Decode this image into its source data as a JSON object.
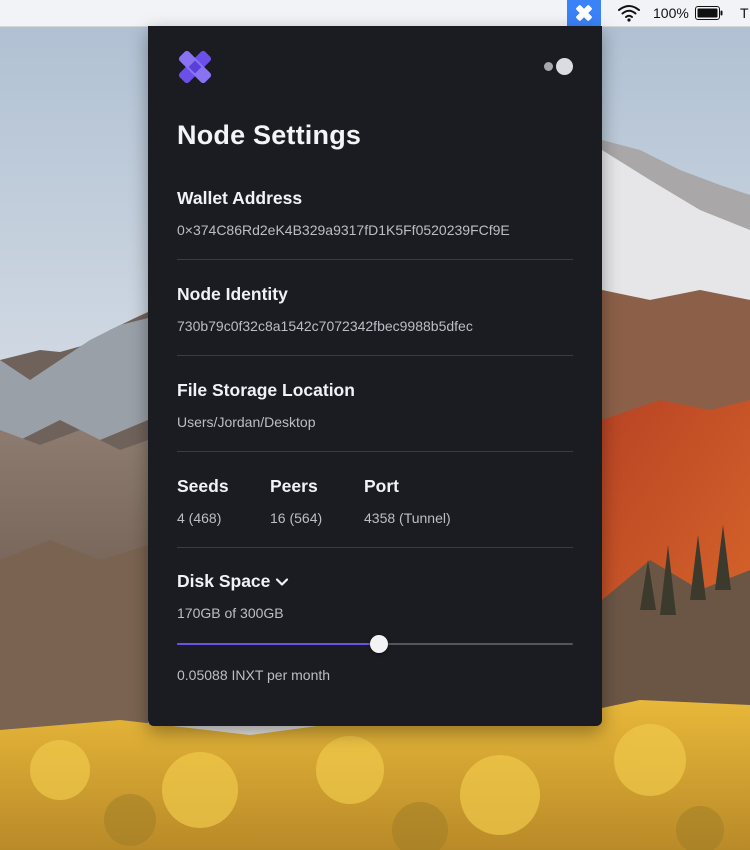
{
  "menubar": {
    "app_icon": "internxt-logo-icon",
    "wifi_icon": "wifi-icon",
    "battery_percent": "100%",
    "battery_icon": "battery-icon",
    "clock_partial": "T"
  },
  "panel": {
    "logo_icon": "internxt-logo-icon",
    "toggle_icon": "status-toggle-icon",
    "title": "Node Settings",
    "wallet": {
      "label": "Wallet Address",
      "value": "0×374C86Rd2eK4B329a9317fD1K5Ff0520239FCf9E"
    },
    "identity": {
      "label": "Node Identity",
      "value": "730b79c0f32c8a1542c7072342fbec9988b5dfec"
    },
    "storage": {
      "label": "File Storage Location",
      "value": "Users/Jordan/Desktop"
    },
    "stats": {
      "seeds_label": "Seeds",
      "seeds_value": "4 (468)",
      "peers_label": "Peers",
      "peers_value": "16 (564)",
      "port_label": "Port",
      "port_value": "4358 (Tunnel)"
    },
    "disk": {
      "label": "Disk Space",
      "chevron_icon": "chevron-down-icon",
      "value": "170GB of 300GB",
      "slider_fraction": 0.51,
      "cost": "0.05088 INXT per month"
    }
  },
  "colors": {
    "panel_bg": "#1b1b22",
    "accent": "#6a52e6",
    "menu_app_bg": "#3b82f6"
  }
}
